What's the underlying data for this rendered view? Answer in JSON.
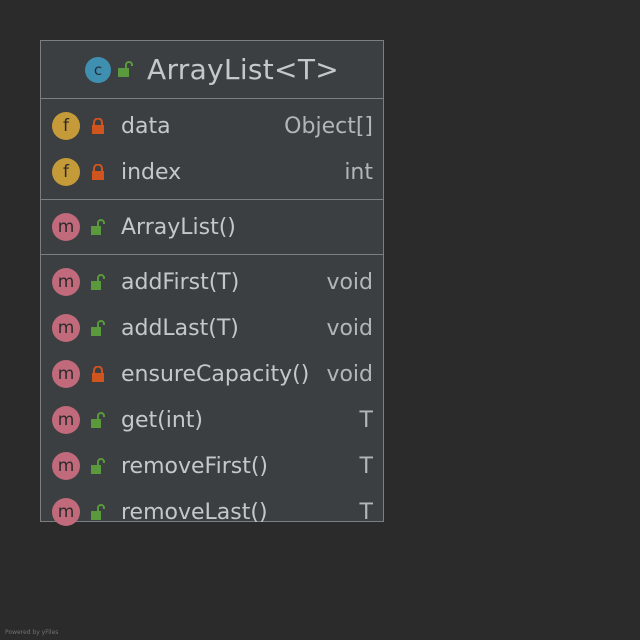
{
  "class": {
    "badge": "c",
    "title": "ArrayList<T>",
    "visibility": "public"
  },
  "fields": [
    {
      "badge": "f",
      "visibility": "private",
      "name": "data",
      "type": "Object[]"
    },
    {
      "badge": "f",
      "visibility": "private",
      "name": "index",
      "type": "int"
    }
  ],
  "constructors": [
    {
      "badge": "m",
      "visibility": "public",
      "name": "ArrayList()",
      "type": ""
    }
  ],
  "methods": [
    {
      "badge": "m",
      "visibility": "public",
      "name": "addFirst(T)",
      "type": "void"
    },
    {
      "badge": "m",
      "visibility": "public",
      "name": "addLast(T)",
      "type": "void"
    },
    {
      "badge": "m",
      "visibility": "private",
      "name": "ensureCapacity()",
      "type": "void"
    },
    {
      "badge": "m",
      "visibility": "public",
      "name": "get(int)",
      "type": "T"
    },
    {
      "badge": "m",
      "visibility": "public",
      "name": "removeFirst()",
      "type": "T"
    },
    {
      "badge": "m",
      "visibility": "public",
      "name": "removeLast()",
      "type": "T"
    }
  ],
  "footer": "Powered by yFiles",
  "colors": {
    "background": "#2b2b2b",
    "box": "#3c3f41",
    "border": "#7b7f82",
    "class_badge": "#3f8fb1",
    "field_badge": "#c59a38",
    "method_badge": "#c06a7b",
    "public_lock": "#5a9a3c",
    "private_lock": "#d0541e"
  }
}
